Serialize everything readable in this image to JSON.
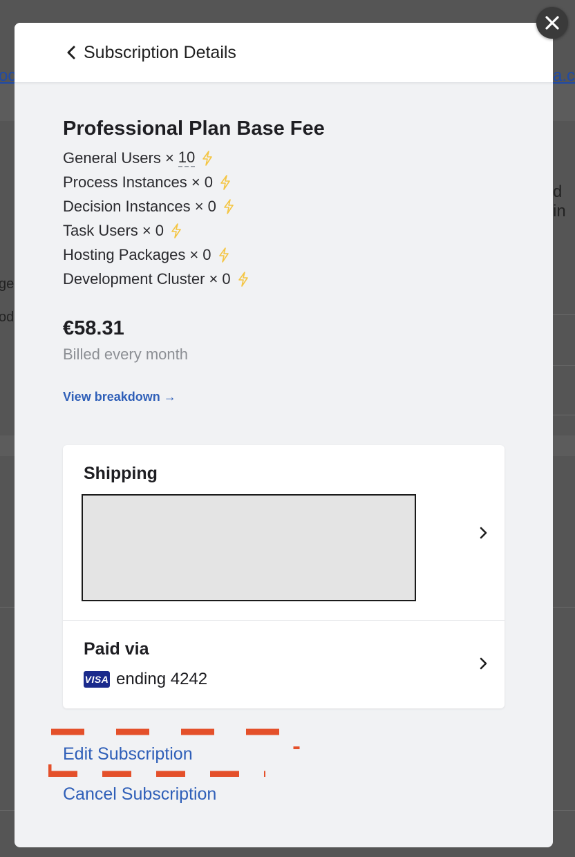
{
  "background": {
    "fragments": [
      "oc",
      "a.co",
      "d in",
      "ge",
      "od"
    ]
  },
  "modal": {
    "header_title": "Subscription Details",
    "plan_title": "Professional Plan Base Fee",
    "items": [
      {
        "label": "General Users ×",
        "qty": "10",
        "qty_editable": true,
        "icon": "lightning-icon"
      },
      {
        "label": "Process Instances ×",
        "qty": "0",
        "icon": "lightning-icon"
      },
      {
        "label": "Decision Instances ×",
        "qty": "0",
        "icon": "lightning-icon"
      },
      {
        "label": "Task Users ×",
        "qty": "0",
        "icon": "lightning-icon"
      },
      {
        "label": "Hosting Packages ×",
        "qty": "0",
        "icon": "lightning-icon"
      },
      {
        "label": "Development Cluster ×",
        "qty": "0",
        "icon": "lightning-icon"
      }
    ],
    "price": "€58.31",
    "billing_period": "Billed every month",
    "breakdown_link": "View breakdown →",
    "shipping": {
      "title": "Shipping"
    },
    "payment": {
      "title": "Paid via",
      "card_brand": "VISA",
      "card_text": "ending 4242"
    },
    "edit_link": "Edit Subscription",
    "cancel_link": "Cancel Subscription"
  },
  "colors": {
    "accent_link": "#2f5fb8",
    "lightning": "#f4c542",
    "annotation": "#e4502a",
    "visa_blue": "#1a2a8c"
  }
}
